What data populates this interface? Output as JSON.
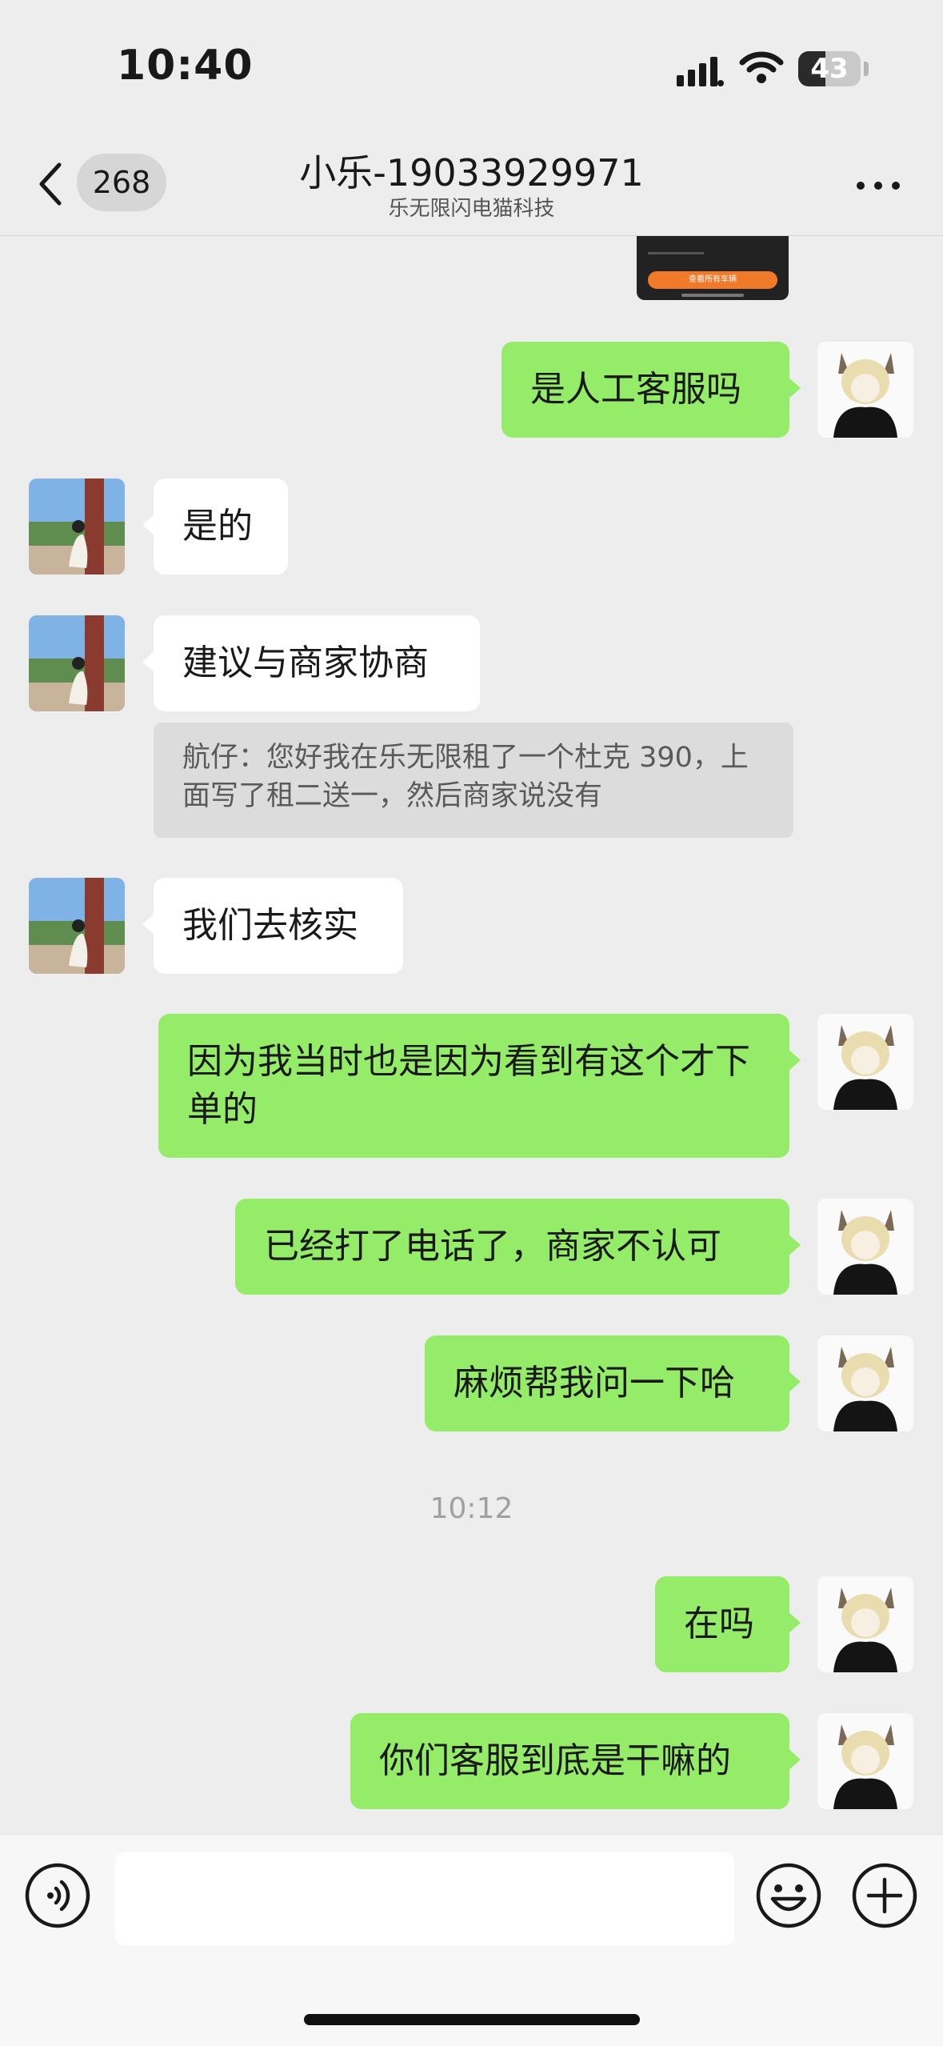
{
  "status_bar": {
    "time": "10:40",
    "battery": "43",
    "battery_level": 0.43
  },
  "header": {
    "back_count": "268",
    "title": "小乐-19033929971",
    "subtitle": "乐无限闪电猫科技"
  },
  "partial_card": {
    "button_label": "查看所有车辆"
  },
  "messages": [
    {
      "from": "me",
      "text": "是人工客服吗"
    },
    {
      "from": "them",
      "text": "是的"
    },
    {
      "from": "them",
      "text": "建议与商家协商"
    },
    {
      "from": "quote",
      "text": "航仔：您好我在乐无限租了一个杜克 390，上面写了租二送一，然后商家说没有"
    },
    {
      "from": "them",
      "text": "我们去核实"
    },
    {
      "from": "me",
      "text": "因为我当时也是因为看到有这个才下单的"
    },
    {
      "from": "me",
      "text": "已经打了电话了，商家不认可"
    },
    {
      "from": "me",
      "text": "麻烦帮我问一下哈"
    },
    {
      "from": "time",
      "text": "10:12"
    },
    {
      "from": "me",
      "text": "在吗"
    },
    {
      "from": "me",
      "text": "你们客服到底是干嘛的"
    }
  ],
  "input": {
    "placeholder": ""
  },
  "colors": {
    "outgoing_bubble": "#95ec69",
    "incoming_bubble": "#ffffff",
    "background": "#ededed"
  },
  "icons": [
    "back-chevron-icon",
    "more-icon",
    "voice-icon",
    "emoji-icon",
    "plus-icon",
    "signal-icon",
    "wifi-icon",
    "battery-icon"
  ]
}
